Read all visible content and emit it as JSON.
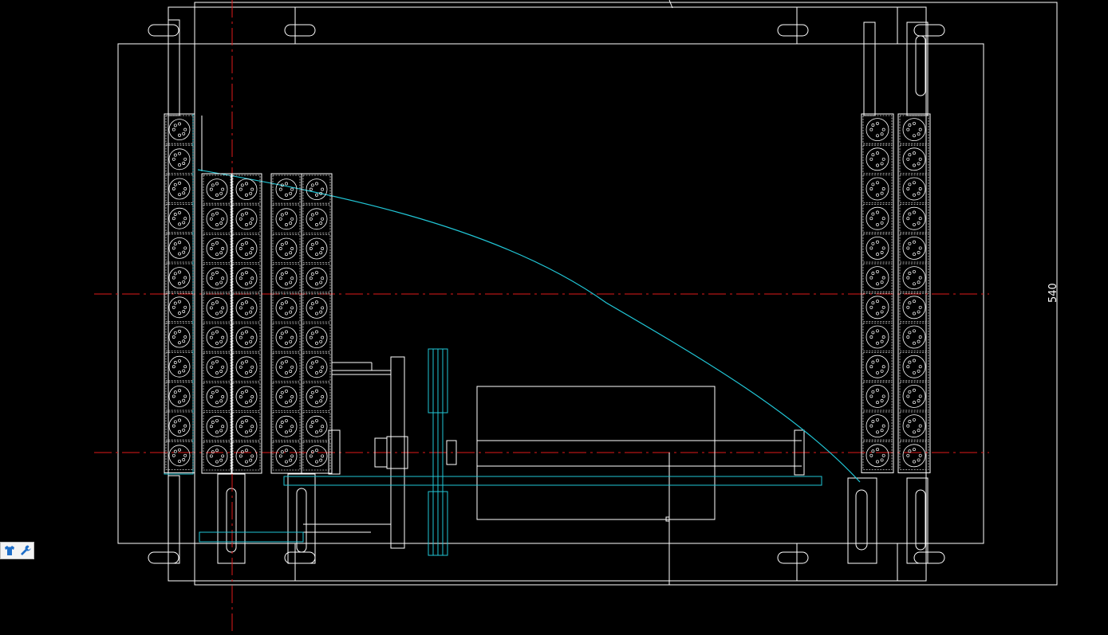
{
  "drawing": {
    "dimension_text": "540",
    "colors": {
      "background": "#000000",
      "geometry": "#ffffff",
      "centerline": "#e01a1a",
      "curve": "#21c6d6",
      "hatch": "#cfcfcf"
    },
    "cell_pattern": "circle-with-holes",
    "columns": [
      {
        "name": "far-left-column",
        "cells": 12
      },
      {
        "name": "left-inner-column-a",
        "cells": 10
      },
      {
        "name": "left-inner-column-b",
        "cells": 10
      },
      {
        "name": "center-left-column-a",
        "cells": 10
      },
      {
        "name": "center-left-column-b",
        "cells": 10
      },
      {
        "name": "right-column-a",
        "cells": 12
      },
      {
        "name": "right-column-b",
        "cells": 12
      }
    ]
  },
  "toolbar": {
    "icons": [
      "shirt-icon",
      "wrench-icon"
    ]
  }
}
